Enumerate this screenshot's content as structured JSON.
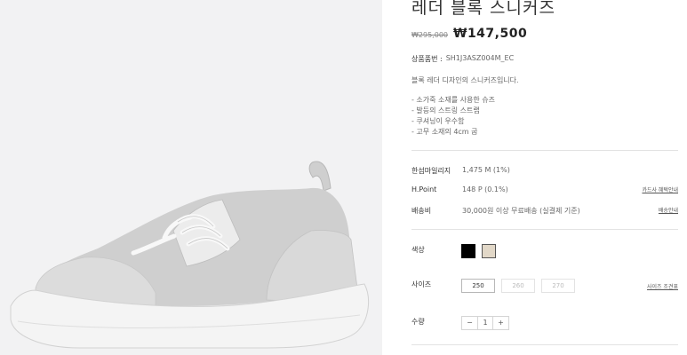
{
  "product": {
    "title": "레더 블록 스니커즈",
    "price_original": "₩295,000",
    "price_sale": "₩147,500",
    "code_label": "상품품번 :",
    "code_value": "SH1J3ASZ004M_EC",
    "description": "블록 레더 디자인의 스니커즈입니다.",
    "bullets": [
      "- 소가죽 소재를 사용한 슈즈",
      "- 발등의 스트링 스트랩",
      "- 쿠셔닝이 우수함",
      "- 고무 소재의 4cm 굽"
    ]
  },
  "benefits": {
    "mileage_label": "한섬마일리지",
    "mileage_value": "1,475 M (1%)",
    "hpoint_label": "H.Point",
    "hpoint_value": "148 P (0.1%)",
    "hpoint_link": "카드사 혜택안내",
    "shipping_label": "배송비",
    "shipping_value": "30,000원 이상 무료배송 (실결제 기준)",
    "shipping_link": "배송안내"
  },
  "options": {
    "color_label": "색상",
    "colors": [
      {
        "name": "black",
        "hex": "#000000"
      },
      {
        "name": "beige",
        "hex": "#e2d8c8"
      }
    ],
    "size_label": "사이즈",
    "sizes": [
      "250",
      "260",
      "270"
    ],
    "size_link": "사이즈 조견표",
    "qty_label": "수량",
    "qty_minus": "−",
    "qty_value": "1",
    "qty_plus": "+"
  }
}
